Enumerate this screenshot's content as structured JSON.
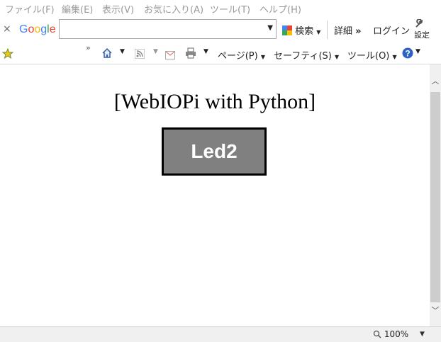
{
  "menu": {
    "items": [
      "ファイル(F)",
      "編集(E)",
      "表示(V)",
      "お気に入り(A)",
      "ツール(T)",
      "ヘルプ(H)"
    ]
  },
  "google_bar": {
    "close_glyph": "×",
    "logo": "Google",
    "search_value": "",
    "search_label": "検索",
    "detail_label": "詳細",
    "login_label": "ログイン",
    "settings_label": "設定"
  },
  "command_bar": {
    "page_label": "ページ(P)",
    "safety_label": "セーフティ(S)",
    "tools_label": "ツール(O)"
  },
  "page": {
    "title": "[WebIOPi with Python]",
    "button_label": "Led2"
  },
  "status_bar": {
    "zoom": "100%"
  },
  "colors": {
    "button_bg": "#808080",
    "logo_blue": "#4285F4",
    "logo_red": "#EA4335",
    "logo_yellow": "#FBBC05",
    "logo_green": "#34A853"
  },
  "icons": [
    "close-icon",
    "search-dropdown-icon",
    "google-search-icon",
    "wrench-icon",
    "favorites-star-icon",
    "home-icon",
    "rss-icon",
    "mail-icon",
    "print-icon",
    "help-icon",
    "zoom-icon"
  ]
}
